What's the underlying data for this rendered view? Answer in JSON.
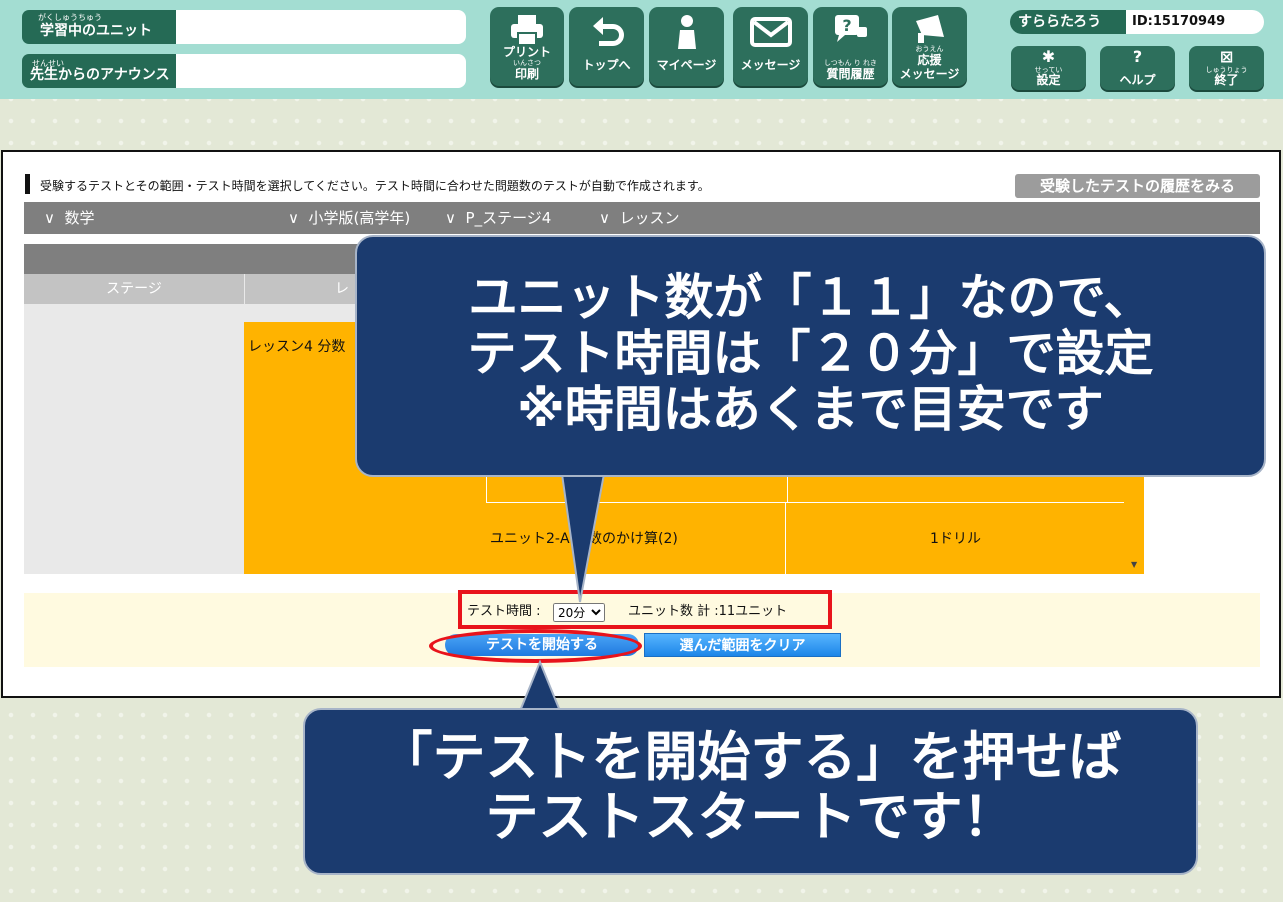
{
  "header": {
    "learning_unit_label": "学習中のユニット",
    "learning_unit_ruby": "がくしゅうちゅう",
    "learning_unit_value": "",
    "announce_label": "先生からのアナウンス",
    "announce_ruby": "せんせい",
    "announce_value": "",
    "nav": [
      {
        "label": "プリント",
        "label2": "印刷",
        "ruby": "いんさつ",
        "icon": "printer-icon"
      },
      {
        "label": "トップへ",
        "icon": "return-arrow-icon"
      },
      {
        "label": "マイページ",
        "icon": "person-icon"
      },
      {
        "label": "メッセージ",
        "icon": "envelope-icon"
      },
      {
        "label": "質問履歴",
        "ruby": "しつもん り れき",
        "icon": "question-chat-icon"
      },
      {
        "label": "応援",
        "label2": "メッセージ",
        "ruby": "おうえん",
        "icon": "megaphone-icon"
      }
    ],
    "user_name": "すららたろう",
    "user_id": "ID:15170949",
    "settings": {
      "label": "設定",
      "ruby": "せってい",
      "icon": "gear-icon"
    },
    "help": {
      "label": "ヘルプ",
      "icon": "question-icon"
    },
    "exit": {
      "label": "終了",
      "ruby": "しゅうりょう",
      "icon": "close-icon"
    }
  },
  "panel": {
    "instruction": "受験するテストとその範囲・テスト時間を選択してください。テスト時間に合わせた問題数のテストが自動で作成されます。",
    "history_button": "受験したテストの履歴をみる",
    "filters": [
      "数学",
      "小学版(高学年)",
      "P_ステージ4",
      "レッスン"
    ],
    "table": {
      "col_stage": "ステージ",
      "col_lesson": "レ",
      "lesson": "レッスン4 分数",
      "unit_name": "ユニット2-A 分数のかけ算(2)",
      "unit_drill": "1ドリル"
    },
    "time_label": "テスト時間 :",
    "time_options": [
      "20分"
    ],
    "time_selected": "20分",
    "unit_count": "ユニット数 計 :11ユニット",
    "start_button": "テストを開始する",
    "clear_button": "選んだ範囲をクリア"
  },
  "callouts": {
    "top": [
      "ユニット数が「１１」なので、",
      "テスト時間は「２０分」で設定",
      "※時間はあくまで目安です"
    ],
    "bottom": [
      "「テストを開始する」を押せば",
      "テストスタートです！"
    ]
  },
  "colors": {
    "header_bg": "#a3ddd2",
    "header_dark": "#2d6f5c",
    "lesson_orange": "#ffb300",
    "callout_navy": "#1b3b6f",
    "highlight_red": "#e8131b"
  }
}
